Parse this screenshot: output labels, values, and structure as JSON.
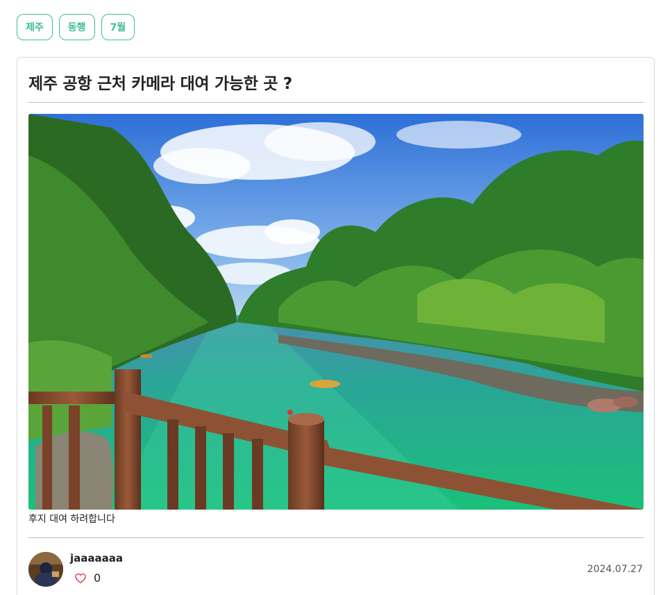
{
  "tags": [
    "제주",
    "동행",
    "7월"
  ],
  "post": {
    "title": "제주 공항 근처 카메라 대여 가능한 곳 ?",
    "body": "후지 대여 하려합니다",
    "author": "jaaaaaaa",
    "likes": "0",
    "date": "2024.07.27"
  },
  "icons": {
    "like": "heart-outline-icon"
  },
  "colors": {
    "tag_accent": "#3dbf8f",
    "heart": "#e0303a",
    "divider": "#bdbdbd"
  }
}
